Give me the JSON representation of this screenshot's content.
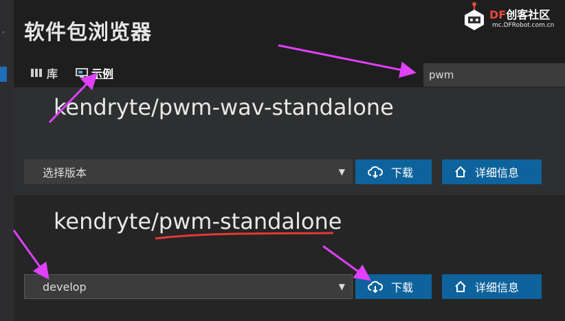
{
  "app": {
    "title": "软件包浏览器"
  },
  "tabs": [
    {
      "label": "库",
      "icon": "library-icon"
    },
    {
      "label": "示例",
      "icon": "example-icon",
      "active": true
    }
  ],
  "search": {
    "value": "pwm"
  },
  "packages": [
    {
      "name": "kendryte/pwm-wav-standalone",
      "version": "选择版本",
      "download": "下载",
      "info": "详细信息"
    },
    {
      "name": "kendryte/pwm-standalone",
      "version": "develop",
      "download": "下载",
      "info": "详细信息"
    }
  ],
  "watermark": {
    "brand_df": "DF",
    "brand_rest": "创客社区",
    "url": "mc.DFRobot.com.cn"
  },
  "colors": {
    "accent": "#0e639c",
    "annotation_arrow": "#e040fb",
    "underline": "#e53935"
  }
}
